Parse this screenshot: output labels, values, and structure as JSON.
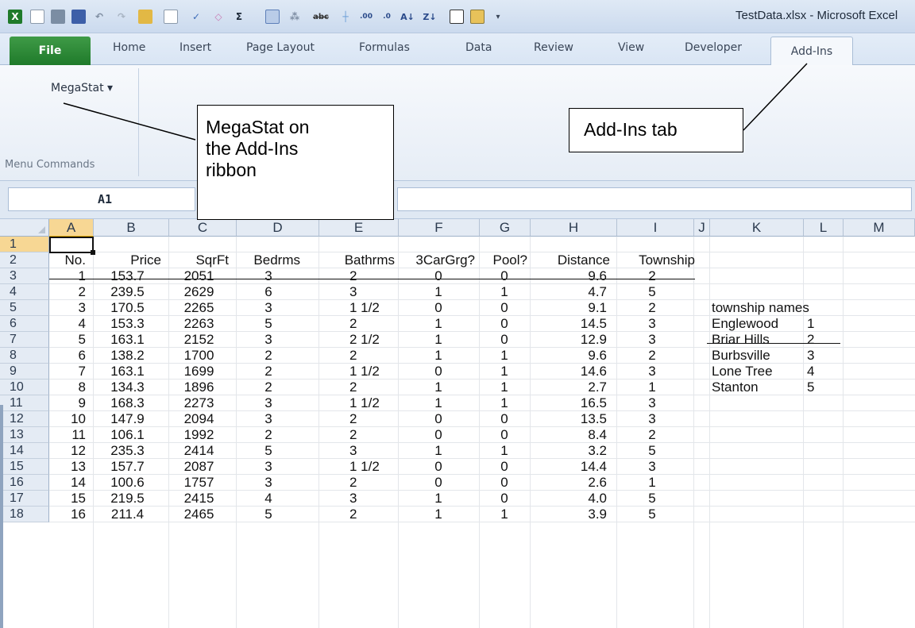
{
  "window": {
    "title": "TestData.xlsx - Microsoft Excel"
  },
  "quick_access_toolbar": [
    "excel-logo-icon",
    "new-doc-icon",
    "print-icon",
    "save-icon",
    "undo-icon",
    "redo-icon",
    "open-folder-icon",
    "print-preview-icon",
    "spelling-icon",
    "eraser-icon",
    "autosum-icon",
    "insert-table-icon",
    "pivot-icon",
    "strikethrough-icon",
    "borders-icon",
    "increase-decimal-icon",
    "decrease-decimal-icon",
    "sort-ascending-icon",
    "sort-descending-icon",
    "checkbox-icon",
    "form-icon",
    "customize-qat-icon"
  ],
  "tabs": {
    "file": "File",
    "home": "Home",
    "insert": "Insert",
    "page_layout": "Page Layout",
    "formulas": "Formulas",
    "data": "Data",
    "review": "Review",
    "view": "View",
    "developer": "Developer",
    "addins": "Add-Ins"
  },
  "ribbon": {
    "megastat_menu": "MegaStat ▾",
    "group_label": "Menu Commands"
  },
  "formula_bar": {
    "name_box": "A1",
    "formula": ""
  },
  "columns": [
    "A",
    "B",
    "C",
    "D",
    "E",
    "F",
    "G",
    "H",
    "I",
    "J",
    "K",
    "L",
    "M"
  ],
  "rows": [
    "1",
    "2",
    "3",
    "4",
    "5",
    "6",
    "7",
    "8",
    "9",
    "10",
    "11",
    "12",
    "13",
    "14",
    "15",
    "16",
    "17",
    "18"
  ],
  "table": {
    "headers": [
      "No.",
      "Price",
      "SqrFt",
      "Bedrms",
      "Bathrms",
      "3CarGrg?",
      "Pool?",
      "Distance",
      "Township"
    ],
    "rows": [
      [
        "1",
        "153.7",
        "2051",
        "3",
        "2",
        "0",
        "0",
        "9.6",
        "2"
      ],
      [
        "2",
        "239.5",
        "2629",
        "6",
        "3",
        "1",
        "1",
        "4.7",
        "5"
      ],
      [
        "3",
        "170.5",
        "2265",
        "3",
        "1 1/2",
        "0",
        "0",
        "9.1",
        "2"
      ],
      [
        "4",
        "153.3",
        "2263",
        "5",
        "2",
        "1",
        "0",
        "14.5",
        "3"
      ],
      [
        "5",
        "163.1",
        "2152",
        "3",
        "2 1/2",
        "1",
        "0",
        "12.9",
        "3"
      ],
      [
        "6",
        "138.2",
        "1700",
        "2",
        "2",
        "1",
        "1",
        "9.6",
        "2"
      ],
      [
        "7",
        "163.1",
        "1699",
        "2",
        "1 1/2",
        "0",
        "1",
        "14.6",
        "3"
      ],
      [
        "8",
        "134.3",
        "1896",
        "2",
        "2",
        "1",
        "1",
        "2.7",
        "1"
      ],
      [
        "9",
        "168.3",
        "2273",
        "3",
        "1 1/2",
        "1",
        "1",
        "16.5",
        "3"
      ],
      [
        "10",
        "147.9",
        "2094",
        "3",
        "2",
        "0",
        "0",
        "13.5",
        "3"
      ],
      [
        "11",
        "106.1",
        "1992",
        "2",
        "2",
        "0",
        "0",
        "8.4",
        "2"
      ],
      [
        "12",
        "235.3",
        "2414",
        "5",
        "3",
        "1",
        "1",
        "3.2",
        "5"
      ],
      [
        "13",
        "157.7",
        "2087",
        "3",
        "1 1/2",
        "0",
        "0",
        "14.4",
        "3"
      ],
      [
        "14",
        "100.6",
        "1757",
        "3",
        "2",
        "0",
        "0",
        "2.6",
        "1"
      ],
      [
        "15",
        "219.5",
        "2415",
        "4",
        "3",
        "1",
        "0",
        "4.0",
        "5"
      ],
      [
        "16",
        "211.4",
        "2465",
        "5",
        "2",
        "1",
        "1",
        "3.9",
        "5"
      ]
    ]
  },
  "township_names": {
    "title": "township names",
    "items": [
      [
        "Englewood",
        "1"
      ],
      [
        "Briar Hills",
        "2"
      ],
      [
        "Burbsville",
        "3"
      ],
      [
        "Lone Tree",
        "4"
      ],
      [
        "Stanton",
        "5"
      ]
    ]
  },
  "callouts": {
    "megastat": [
      "MegaStat on",
      "the Add-Ins",
      "ribbon"
    ],
    "addins": "Add-Ins tab"
  },
  "colors": {
    "file_tab": "#2a8a36",
    "selection_header": "#f7d794",
    "ribbon_bg": "#eef3f9"
  }
}
